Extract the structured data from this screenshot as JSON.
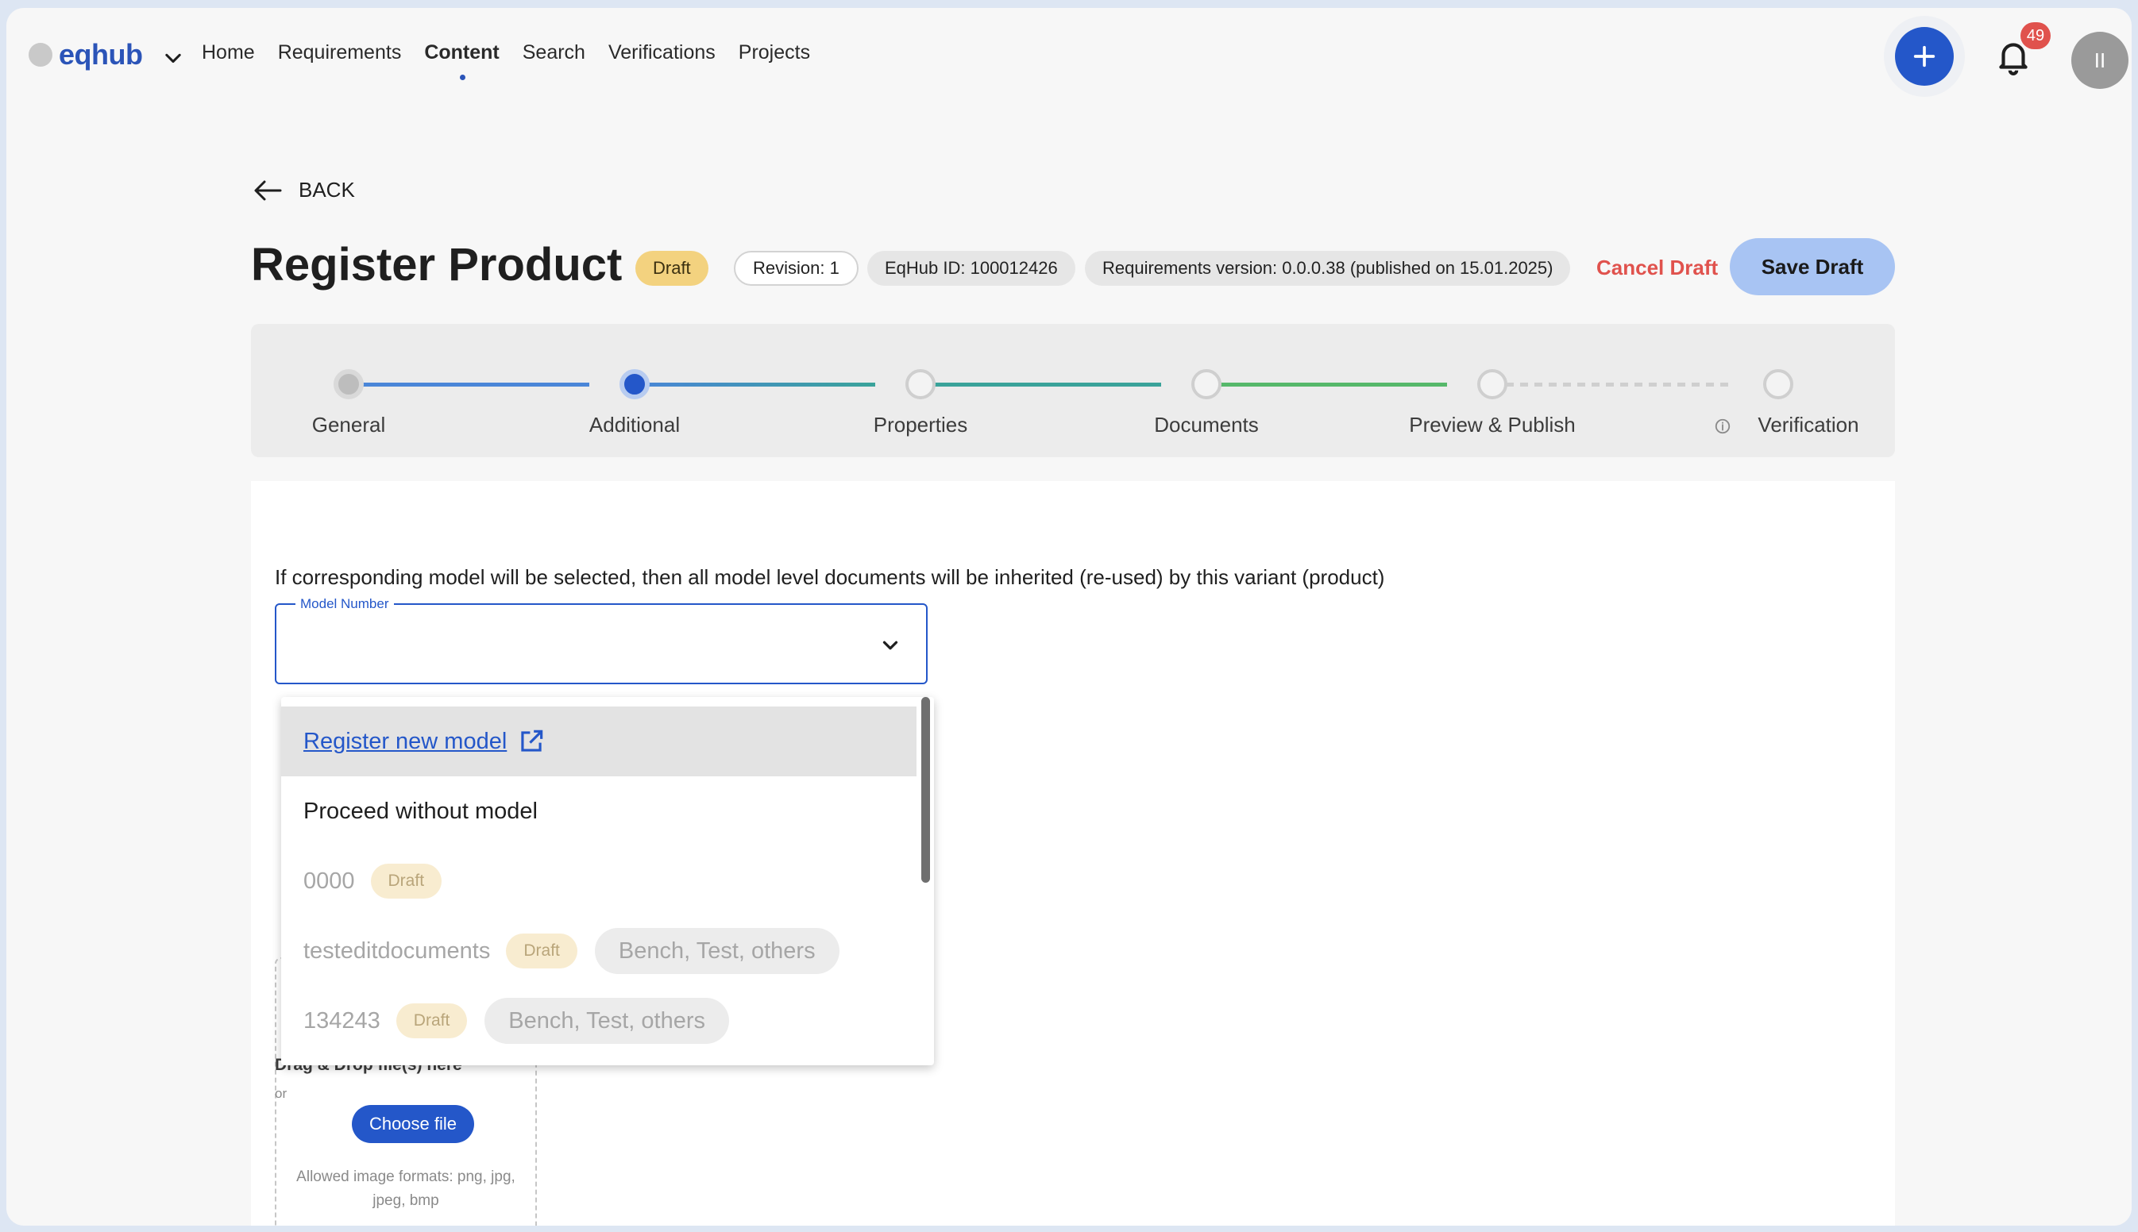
{
  "nav": {
    "logo": "eqhub",
    "links": [
      "Home",
      "Requirements",
      "Content",
      "Search",
      "Verifications",
      "Projects"
    ],
    "active": "Content",
    "notification_count": "49",
    "avatar_initials": "II"
  },
  "header": {
    "back_label": "BACK",
    "title": "Register Product",
    "status_chip": "Draft",
    "revision_chip": "Revision: 1",
    "eqhub_id_chip": "EqHub ID: 100012426",
    "requirements_chip": "Requirements version: 0.0.0.38 (published on 15.01.2025)",
    "cancel_label": "Cancel Draft",
    "save_label": "Save Draft"
  },
  "stepper": {
    "steps": [
      "General",
      "Additional",
      "Properties",
      "Documents",
      "Preview & Publish",
      "Verification"
    ],
    "current_index": 1
  },
  "form": {
    "info_text": "If corresponding model will be selected, then all model level documents will be inherited (re-used) by this variant (product)",
    "model_number_label": "Model Number",
    "model_number_value": ""
  },
  "dropdown": {
    "register_new_model": "Register new model",
    "proceed_without_model": "Proceed without model",
    "options": [
      {
        "name": "0000",
        "status": "Draft",
        "category": ""
      },
      {
        "name": "testeditdocuments",
        "status": "Draft",
        "category": "Bench, Test, others"
      },
      {
        "name": "134243",
        "status": "Draft",
        "category": "Bench, Test, others"
      }
    ]
  },
  "upload": {
    "title": "Drag & Drop file(s) here",
    "or": "or",
    "button": "Choose file",
    "hint": "Allowed image formats: png, jpg, jpeg, bmp"
  },
  "colors": {
    "accent": "#2457c9",
    "danger": "#e0524d",
    "draft_chip": "#f3d27f",
    "save_button": "#a8c4f3",
    "line_blue": "#4a86d8",
    "line_teal": "#3aa39a",
    "line_green": "#56b86a"
  }
}
